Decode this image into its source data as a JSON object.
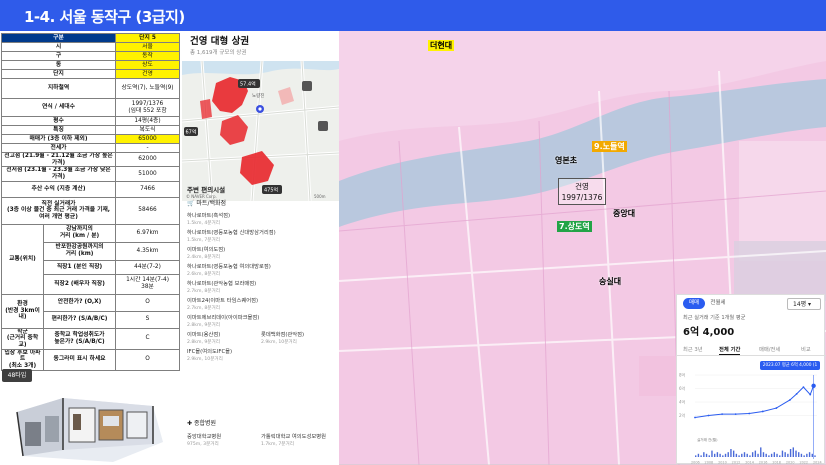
{
  "header": {
    "title": "1-4. 서울 동작구 (3급지)"
  },
  "table": {
    "head": {
      "label": "구분",
      "value": "단지 5"
    },
    "rows": [
      {
        "label": "시",
        "value": "서울",
        "yellow": true
      },
      {
        "label": "구",
        "value": "동작",
        "yellow": true
      },
      {
        "label": "동",
        "value": "상도",
        "yellow": true
      },
      {
        "label": "단지",
        "value": "건영",
        "yellow": true
      },
      {
        "label": "지하철역",
        "value": "상도역(7), 노들역(9)"
      },
      {
        "label": "연식 / 세대수",
        "value": "1997/1376\n(임대 552 포함"
      },
      {
        "label": "평수",
        "value": "14평(4층)"
      },
      {
        "label": "특징",
        "value": "복도식"
      },
      {
        "label": "매매가 (3층 이하 제외)",
        "value": "65000",
        "yellow": true
      },
      {
        "label": "전세가",
        "value": "-"
      },
      {
        "label": "전고점 (21.9월 - 21.12월 조금 가장 높은 가격)",
        "value": "62000"
      },
      {
        "label": "전저점 (23.1월 - 23.3월 조금 가장 낮은 가격)",
        "value": "51000"
      },
      {
        "label": "추산 수익 (지층 계산)",
        "value": "7466"
      },
      {
        "label": "직전 실거래가\n(3층 이상 물건 중 최근 거래 가격을 기재,\n여러 개면 평균)",
        "value": "58466"
      }
    ],
    "transport": {
      "group": "교통(위치)",
      "rows": [
        {
          "label": "강남까지의\n거리 (km / 분)",
          "value": "6.97km"
        },
        {
          "label": "반포한강공원까지의\n거리 (km)",
          "value": "4.35km"
        },
        {
          "label": "직장1 (분인 직장)",
          "value": "44분(7-2)"
        },
        {
          "label": "직장2 (배우자 직장)",
          "value": "1시간 14분(7-4)\n38분"
        }
      ]
    },
    "env": {
      "group": "환경\n(반경 3km이내)",
      "rows": [
        {
          "label": "안전한가? (O,X)",
          "value": "O"
        },
        {
          "label": "편리한가? (S/A/B/C)",
          "value": "S"
        }
      ]
    },
    "school": {
      "group1": "학군\n(근거리 중학교)",
      "row1": {
        "label": "중학교 학업성취도가\n높은가? (S/A/B/C)",
        "value": "C"
      },
      "group2": "입장 후보 아파트\n(최소 3개)",
      "row2": {
        "label": "동그라미 표시 하세요",
        "value": "O"
      }
    }
  },
  "btn48": "48타입",
  "middle": {
    "title": "건영 대형 상권",
    "subtitle": "총 1,619개 규모의 상권",
    "map_labels": {
      "price1": "57.4억",
      "price2": "67억",
      "price3": "475억",
      "naver": "© NAVER Corp.",
      "scale": "500m",
      "place": "노량진"
    },
    "section_title": "주변 편의시설",
    "cat1": "마트/백화점",
    "pois": [
      {
        "name": "하나로마트(흑석점)",
        "dist": "1.5km, 4분거리"
      },
      {
        "name": "하나로마트(영등포농협 신대방삼거리점)",
        "dist": "1.5km, 7분거리"
      },
      {
        "name": "이마트(여의도점)",
        "dist": "2.4km, 8분거리"
      },
      {
        "name": "하나로마트(영등포농협 여의대방로점)",
        "dist": "2.6km, 8분거리"
      },
      {
        "name": "하나로마트(관악농협 보라매점)",
        "dist": "2.7km, 8분거리"
      },
      {
        "name": "이마트24(이마트 타임스퀘어점)",
        "dist": "2.7km, 8분거리"
      },
      {
        "name": "이마트에브리데이(아이파크몰점)",
        "dist": "2.8km, 9분거리"
      },
      {
        "name": "이마트(용산점)",
        "dist": "2.8km, 9분거리"
      },
      {
        "name": "롯데백화점(관악점)",
        "dist": "2.9km, 10분거리"
      },
      {
        "name": "IFC몰(여의도IFC몰)",
        "dist": "2.9km, 10분거리"
      }
    ],
    "cat2": "종합병원",
    "hospitals": [
      {
        "name": "중앙대학교병원",
        "dist": "975m, 3분거리"
      },
      {
        "name": "가톨릭대학교 여의도성모병원",
        "dist": "1.7km, 7분거리"
      }
    ]
  },
  "big_map": {
    "labels": {
      "top": "더현대",
      "yeongbon": "영본초",
      "nodeul": "9.노들역",
      "jungang": "중앙대",
      "sangdo": "7.상도역",
      "soongsil": "숭실대"
    },
    "apt_name": "건영",
    "apt_info": "1997/1376"
  },
  "price_card": {
    "pill_active": "매매",
    "pill_inactive": "전월세",
    "dropdown": "14평 ▾",
    "desc": "최근 실거래 기준 1개월 평균",
    "price": "6억 4,000",
    "tabs": [
      "최근 3년",
      "전체 기간",
      "매매/전세",
      "비교"
    ],
    "active_tab": "전체 기간",
    "tooltip": "2023.07 평균 6억 4,000 (1건)",
    "axis_label": "실거래 건(월)",
    "accent": "#2a5cf0"
  },
  "chart_data": {
    "type": "line",
    "title": "",
    "xlabel": "",
    "ylabel": "",
    "x": [
      2006,
      2008,
      2010,
      2012,
      2014,
      2016,
      2018,
      2020,
      2021,
      2022,
      2023,
      2023.5
    ],
    "ylim": [
      0,
      8
    ],
    "x_ticks": [
      "2006",
      "2008",
      "2010",
      "2012",
      "2014",
      "2016",
      "2018",
      "2020",
      "2022",
      "2024"
    ],
    "y_ticks": [
      "8억",
      "6억",
      "4억",
      "2억"
    ],
    "series": [
      {
        "values": [
          1.7,
          2.0,
          2.2,
          2.2,
          2.3,
          2.6,
          3.1,
          4.3,
          5.2,
          6.2,
          5.1,
          6.4
        ]
      }
    ],
    "grid": true
  }
}
